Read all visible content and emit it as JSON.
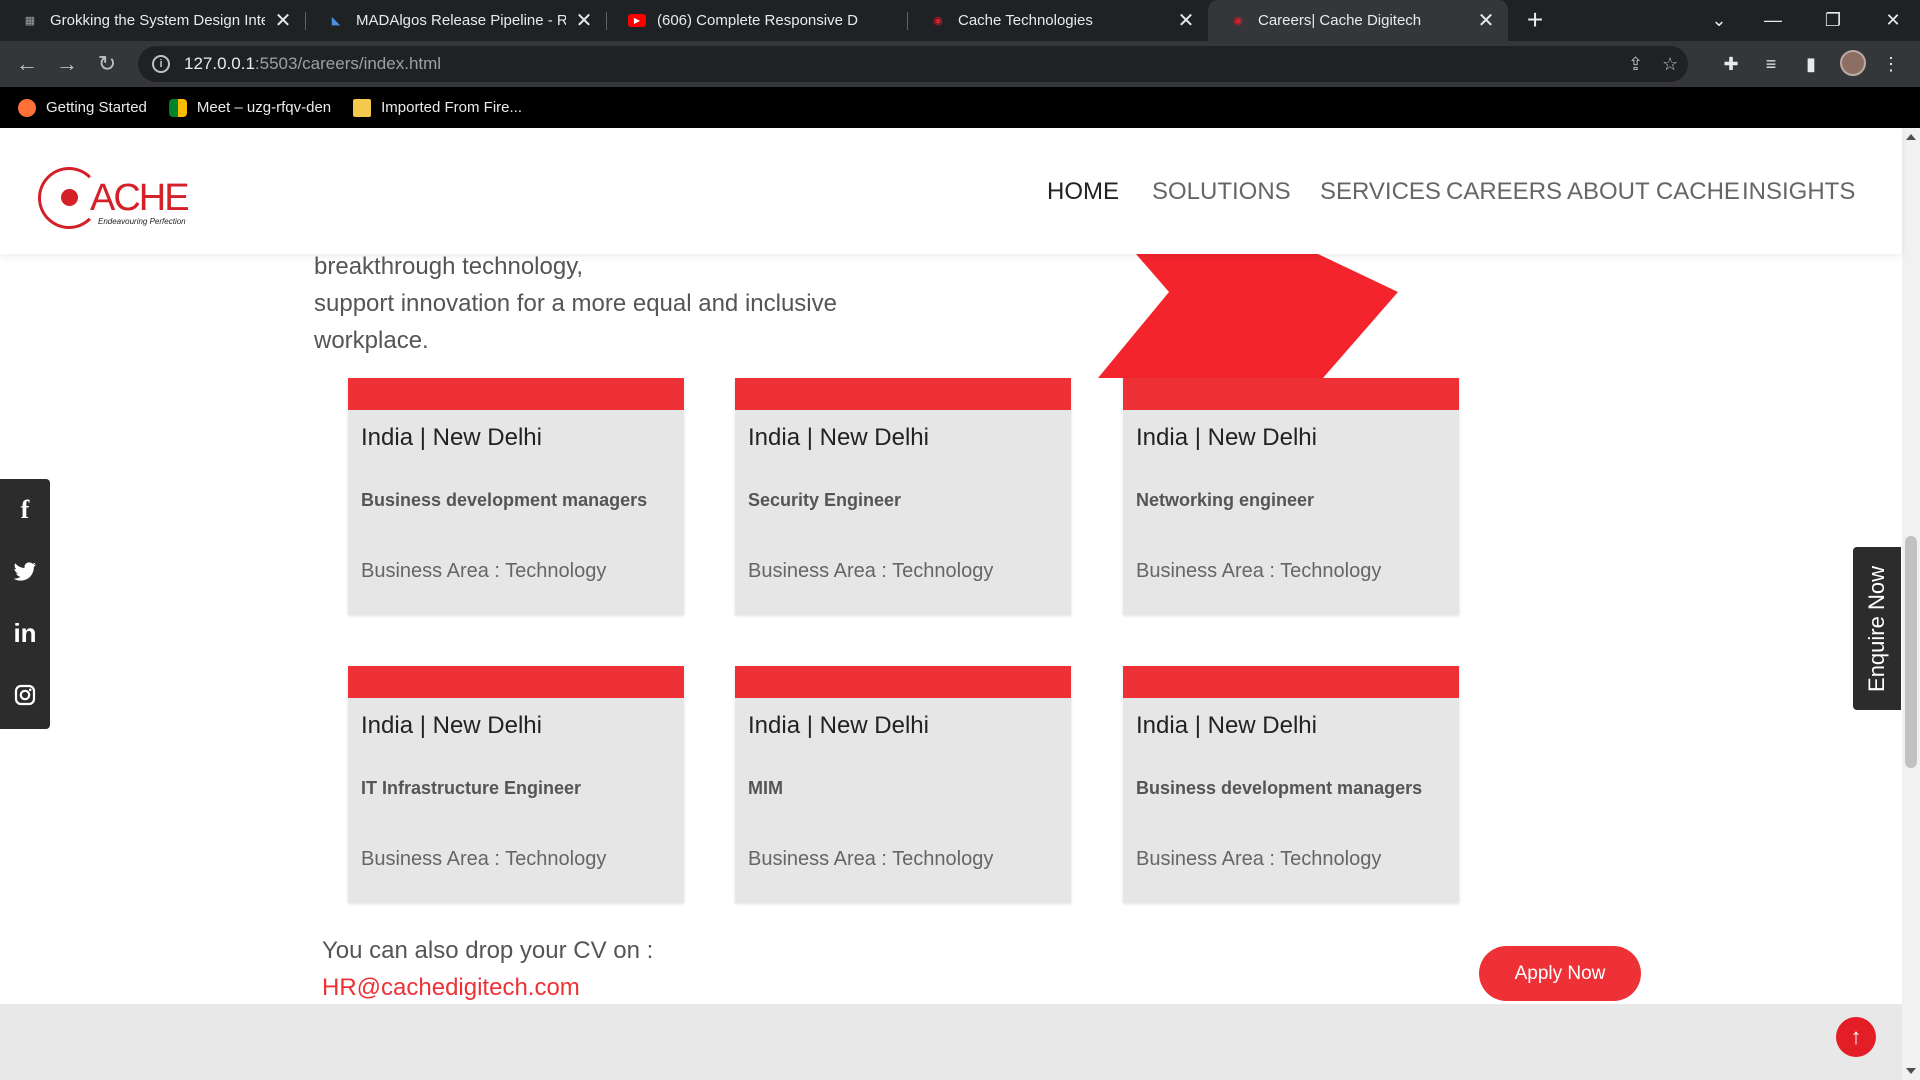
{
  "browser": {
    "tabs": [
      {
        "title": "Grokking the System Design Inte",
        "active": false
      },
      {
        "title": "MADAlgos Release Pipeline - Rel",
        "active": false
      },
      {
        "title": "(606) Complete Responsive D",
        "active": false
      },
      {
        "title": "Cache Technologies",
        "active": false
      },
      {
        "title": "Careers| Cache Digitech",
        "active": true
      }
    ],
    "url_host": "127.0.0.1",
    "url_rest": ":5503/careers/index.html",
    "bookmarks": [
      {
        "label": "Getting Started"
      },
      {
        "label": "Meet – uzg-rfqv-den"
      },
      {
        "label": "Imported From Fire..."
      }
    ]
  },
  "site": {
    "logo": {
      "word": "ACHE",
      "tagline": "Endeavouring Perfection"
    },
    "nav": [
      "HOME",
      "SOLUTIONS",
      "SERVICES",
      "CAREERS",
      "ABOUT CACHE",
      "INSIGHTS"
    ],
    "intro_lines": [
      "breakthrough technology,",
      "support innovation for a more equal and inclusive",
      "workplace."
    ],
    "jobs": [
      {
        "location": "India | New Delhi",
        "role": "Business development managers",
        "area": "Business Area : Technology"
      },
      {
        "location": "India | New Delhi",
        "role": "Security Engineer",
        "area": "Business Area : Technology"
      },
      {
        "location": "India | New Delhi",
        "role": "Networking engineer",
        "area": "Business Area : Technology"
      },
      {
        "location": "India | New Delhi",
        "role": "IT Infrastructure Engineer",
        "area": "Business Area : Technology"
      },
      {
        "location": "India | New Delhi",
        "role": "MIM",
        "area": "Business Area : Technology"
      },
      {
        "location": "India | New Delhi",
        "role": "Business development managers",
        "area": "Business Area : Technology"
      }
    ],
    "cv_text": "You can also drop your CV on :",
    "cv_email": "HR@cachedigitech.com",
    "apply_label": "Apply Now",
    "enquire_label": "Enquire Now",
    "social": [
      "f",
      "t",
      "in",
      "ig"
    ]
  },
  "colors": {
    "brand_red": "#ee3137",
    "dark_panel": "#2c2c2c"
  }
}
